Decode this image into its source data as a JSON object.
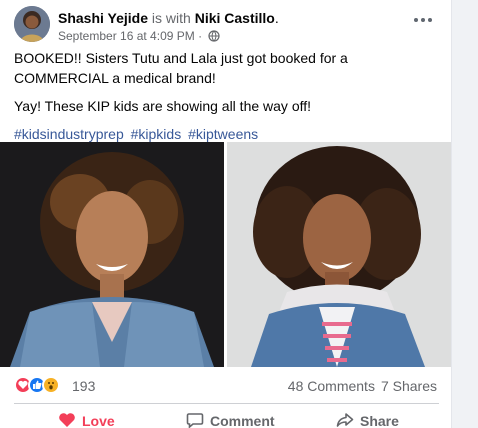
{
  "post": {
    "author": "Shashi Yejide",
    "with_text": " is with ",
    "tagged": "Niki Castillo",
    "tagged_suffix": ".",
    "timestamp": "September 16 at 4:09 PM",
    "meta_separator": " · ",
    "privacy_icon": "globe-icon",
    "more_icon": "more-options-icon",
    "paragraph1": "BOOKED!! Sisters Tutu and Lala just got booked for a COMMERCIAL a medical brand!",
    "paragraph2": "Yay! These KIP kids are showing all the way off!",
    "hashtags": [
      "#kidsindustryprep",
      "#kipkids",
      "#kiptweens"
    ]
  },
  "reactions": {
    "icons": [
      "love-reaction-icon",
      "like-reaction-icon",
      "wow-reaction-icon"
    ],
    "count": "193",
    "comments": "48 Comments",
    "shares": "7 Shares"
  },
  "actions": {
    "love_label": "Love",
    "comment_label": "Comment",
    "share_label": "Share"
  },
  "colors": {
    "link": "#385898",
    "love": "#f33e58",
    "like": "#1877f2",
    "wow": "#f7b125",
    "muted": "#65676b"
  }
}
